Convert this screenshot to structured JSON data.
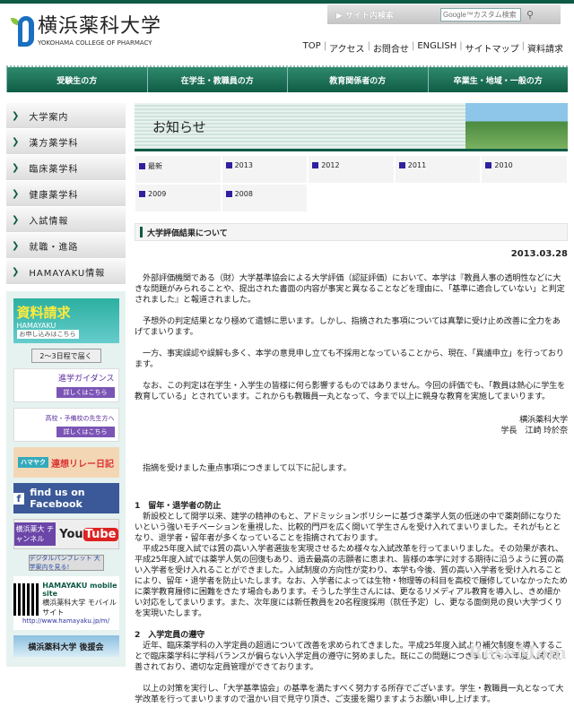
{
  "logo": {
    "jp": "横浜薬科大学",
    "en": "YOKOHAMA COLLEGE OF PHARMACY"
  },
  "search": {
    "label": "▶ サイト内検索",
    "placeholder": "Google™カスタム検索"
  },
  "top_links": [
    "TOP",
    "アクセス",
    "お問合せ",
    "ENGLISH",
    "サイトマップ",
    "資料請求"
  ],
  "global_nav": [
    "受験生の方",
    "在学生・教職員の方",
    "教育関係者の方",
    "卒業生・地域・一般の方"
  ],
  "sidebar": {
    "items": [
      "大学案内",
      "漢方薬学科",
      "臨床薬学科",
      "健康薬学科",
      "入試情報",
      "就職・進路",
      "HAMAYAKU情報"
    ],
    "banners": {
      "request_title": "資料請求",
      "request_sub": "HAMAYAKU",
      "request_more": "お申し込みはこちら",
      "delivery": "2〜3日程で届く",
      "guidance": "進学ガイダンス",
      "teachers": "高校・予備校の先生方へ",
      "details": "詳しくはこちら",
      "diary_tag": "ハマヤク",
      "diary": "連想リレー日記",
      "facebook": "find us on Facebook",
      "yt_channel": "横浜薬大 チャンネル",
      "youtube_you": "You",
      "youtube_tube": "Tube",
      "pamphlet": "デジタルパンフレット 大学案内を見る!",
      "mobile_title": "HAMAYAKU mobile site",
      "mobile_jp": "横浜薬科大学 モバイルサイト",
      "mobile_url": "http://www.hamayaku.jp/m/",
      "support": "横浜薬科大学 後援会"
    }
  },
  "page_title": "お知らせ",
  "year_tabs": [
    "最新",
    "2013",
    "2012",
    "2011",
    "2010",
    "2009",
    "2008"
  ],
  "article": {
    "title": "大学評価結果について",
    "date": "2013.03.28",
    "paragraphs": [
      "　外部評価機関である（財）大学基準協会による大学評価（認証評価）において、本学は『教員人事の透明性などに大きな問題がみられることや、提出された書面の内容が事実と異なることなどを理由に、「基準に適合していない」と判定されました』と報道されました。",
      "　予想外の判定結果となり極めて遺憾に思います。しかし、指摘された事項については真摯に受け止め改善に全力をあげてまいります。",
      "　一方、事実誤認や誤解も多く、本学の意見申し立ても不採用となっていることから、現在、「異議申立」を行っております。",
      "　なお、この判定は在学生・入学生の皆様に何ら影響するものではありません。今回の評価でも、「教員は熱心に学生を教育している」とされています。これからも教職員一丸となって、今まで以上に親身な教育を実施してまいります。"
    ],
    "sign_org": "横浜薬科大学",
    "sign_name": "学長　江崎 玲於奈",
    "intro": "　指摘を受けました重点事項につきまして以下に記します。",
    "s1_title": "1　留年・退学者の防止",
    "s1_p1": "　新設校として開学以来、建学の精神のもと、アドミッションポリシーに基づき薬学人気の低迷の中で薬剤師になりたいという強いモチベーションを重視した、比較的門戸を広く開いて学生さんを受け入れてまいりました。それがもととなり、退学者・留年者が多くなっていることを指摘されております。",
    "s1_p2": "　平成25年度入試では質の高い入学者選抜を実現させるため様々な入試改革を行ってまいりました。その効果が表れ、平成25年度入試では薬学人気の回復もあり、過去最高の志願者に恵まれ、皆様の本学に対する期待に沿うように質の高い入学者を受け入れることができました。入試制度の方向性が変わり、本学も今後、質の高い入学者を受け入れることにより、留年・退学者を防止いたします。なお、入学者によっては生物・物理等の科目を高校で履修していなかったために薬学教育履修に困難をきたす場合もあります。そうした学生さんには、更なるリメディアル教育を導入し、きめ細かい対応をしてまいります。また、次年度には新任教員を20名程度採用（就任予定）し、更なる面倒見の良い大学づくりを実現いたします。",
    "s2_title": "2　入学定員の遵守",
    "s2_p1": "　近年、臨床薬学科の入学定員の超過について改善を求められてきました。平成25年度入試より補欠制度を導入することで臨床薬学科に学科バランスが偏らない入学定員の遵守に努めました。既にこの問題につきましても本年度入試で改善されており、適切な定員管理ができております。",
    "closing": "　以上の対策を実行し、「大学基準協会」の基準を満たすべく努力する所存でございます。学生・教職員一丸となって大学改革を行ってまいりますので温かい目で見守り頂き、ご支援を賜りますようお願い申し上げます。"
  },
  "watermark": "ReseMom",
  "colors": {
    "brand_green": "#0d5a45",
    "accent_purple": "#3020a0"
  }
}
